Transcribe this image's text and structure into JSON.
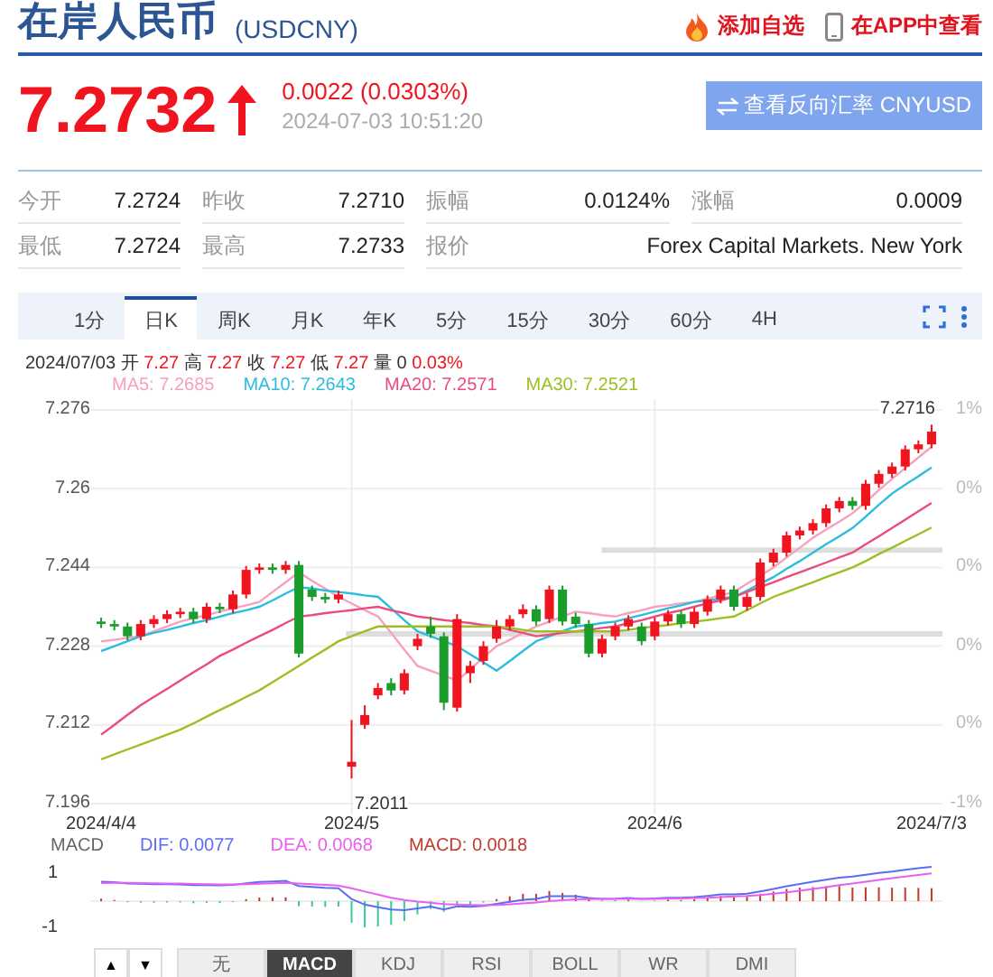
{
  "header": {
    "title": "在岸人民币",
    "code": "(USDCNY)",
    "actions": [
      {
        "kind": "watchlist",
        "label": "添加自选"
      },
      {
        "kind": "app",
        "label": "在APP中查看"
      }
    ]
  },
  "quote": {
    "price": "7.2732",
    "rising": true,
    "change": "0.0022 (0.0303%)",
    "time": "2024-07-03 10:51:20",
    "reverse_button": "查看反向汇率 CNYUSD"
  },
  "stats": [
    [
      {
        "label": "今开",
        "value": "7.2724"
      },
      {
        "label": "昨收",
        "value": "7.2710"
      },
      {
        "label": "振幅",
        "value": "0.0124%"
      },
      {
        "label": "涨幅",
        "value": "0.0009"
      }
    ],
    [
      {
        "label": "最低",
        "value": "7.2724"
      },
      {
        "label": "最高",
        "value": "7.2733"
      },
      {
        "label": "报价",
        "value": "Forex Capital Markets. New York"
      }
    ]
  ],
  "tabs": [
    {
      "label": "1分",
      "selected": false
    },
    {
      "label": "日K",
      "selected": true
    },
    {
      "label": "周K",
      "selected": false
    },
    {
      "label": "月K",
      "selected": false
    },
    {
      "label": "年K",
      "selected": false
    },
    {
      "label": "5分",
      "selected": false
    },
    {
      "label": "15分",
      "selected": false
    },
    {
      "label": "30分",
      "selected": false
    },
    {
      "label": "60分",
      "selected": false
    },
    {
      "label": "4H",
      "selected": false
    }
  ],
  "ohlc": {
    "date": "2024/07/03",
    "fields": [
      {
        "label": "开",
        "value": "7.27",
        "highlighted": true
      },
      {
        "label": "高",
        "value": "7.27",
        "highlighted": true
      },
      {
        "label": "收",
        "value": "7.27",
        "highlighted": true
      },
      {
        "label": "低",
        "value": "7.27",
        "highlighted": true
      },
      {
        "label": "量",
        "value": "0",
        "highlighted": false
      }
    ],
    "change": "0.03%"
  },
  "chart": {
    "ma_values": [
      ": 7.2685",
      ": 7.2643",
      ": 7.2571",
      ": 7.2521"
    ],
    "chart_data": {
      "type": "candlestick",
      "grid": true,
      "ylim": [
        7.196,
        7.276
      ],
      "yticks": [
        {
          "value": 7.276,
          "label": "7.276"
        },
        {
          "value": 7.26,
          "label": "7.26"
        },
        {
          "value": 7.244,
          "label": "7.244"
        },
        {
          "value": 7.228,
          "label": "7.228"
        },
        {
          "value": 7.212,
          "label": "7.212"
        },
        {
          "value": 7.196,
          "label": "7.196"
        }
      ],
      "categories": [
        "2024/4/4",
        null,
        null,
        null,
        null,
        null,
        null,
        null,
        null,
        null,
        null,
        null,
        null,
        null,
        null,
        null,
        null,
        null,
        null,
        "2024/5",
        null,
        null,
        null,
        null,
        null,
        null,
        null,
        null,
        null,
        null,
        null,
        null,
        null,
        null,
        null,
        null,
        null,
        null,
        null,
        null,
        null,
        null,
        "2024/6",
        null,
        null,
        null,
        null,
        null,
        null,
        null,
        null,
        null,
        null,
        null,
        null,
        null,
        null,
        null,
        null,
        null,
        null,
        null,
        null,
        "2024/7/3"
      ],
      "ohlc": [
        [
          7.233,
          7.2338,
          7.2317,
          7.2325
        ],
        [
          7.2325,
          7.2333,
          7.2312,
          7.232
        ],
        [
          7.232,
          7.2328,
          7.2292,
          7.23
        ],
        [
          7.23,
          7.2333,
          7.2292,
          7.2325
        ],
        [
          7.2325,
          7.2343,
          7.2317,
          7.2335
        ],
        [
          7.2335,
          7.2353,
          7.2327,
          7.2345
        ],
        [
          7.2345,
          7.2358,
          7.2337,
          7.235
        ],
        [
          7.235,
          7.2358,
          7.2327,
          7.2335
        ],
        [
          7.2335,
          7.2368,
          7.2327,
          7.236
        ],
        [
          7.236,
          7.2368,
          7.2347,
          7.2355
        ],
        [
          7.2355,
          7.2393,
          7.2347,
          7.2385
        ],
        [
          7.2385,
          7.2443,
          7.2377,
          7.2435
        ],
        [
          7.2435,
          7.2448,
          7.2427,
          7.244
        ],
        [
          7.244,
          7.2448,
          7.2427,
          7.2435
        ],
        [
          7.2435,
          7.2453,
          7.2427,
          7.2445
        ],
        [
          7.2445,
          7.2453,
          7.2257,
          7.2265
        ],
        [
          7.2395,
          7.2403,
          7.2372,
          7.238
        ],
        [
          7.238,
          7.2388,
          7.2367,
          7.2375
        ],
        [
          7.2375,
          7.2393,
          7.2367,
          7.2385
        ],
        [
          7.2035,
          7.213,
          7.2011,
          7.2045
        ],
        [
          7.212,
          7.216,
          7.2112,
          7.214
        ],
        [
          7.218,
          7.2205,
          7.2172,
          7.2195
        ],
        [
          7.2205,
          7.2215,
          7.218,
          7.219
        ],
        [
          7.219,
          7.2233,
          7.2182,
          7.2225
        ],
        [
          7.228,
          7.2305,
          7.2272,
          7.2295
        ],
        [
          7.232,
          7.234,
          7.2297,
          7.2305
        ],
        [
          7.23,
          7.2308,
          7.215,
          7.2165
        ],
        [
          7.2155,
          7.2345,
          7.2147,
          7.2335
        ],
        [
          7.2225,
          7.225,
          7.2205,
          7.224
        ],
        [
          7.225,
          7.229,
          7.2242,
          7.228
        ],
        [
          7.2295,
          7.2333,
          7.2287,
          7.232
        ],
        [
          7.232,
          7.2343,
          7.2312,
          7.2335
        ],
        [
          7.2345,
          7.2365,
          7.2337,
          7.2355
        ],
        [
          7.2355,
          7.2363,
          7.2322,
          7.233
        ],
        [
          7.2335,
          7.2403,
          7.2327,
          7.2395
        ],
        [
          7.2395,
          7.2403,
          7.2322,
          7.233
        ],
        [
          7.234,
          7.2348,
          7.2317,
          7.2325
        ],
        [
          7.2325,
          7.2333,
          7.2257,
          7.2265
        ],
        [
          7.2265,
          7.2303,
          7.2257,
          7.2295
        ],
        [
          7.23,
          7.2328,
          7.2292,
          7.232
        ],
        [
          7.232,
          7.2343,
          7.2312,
          7.2335
        ],
        [
          7.232,
          7.2328,
          7.2282,
          7.229
        ],
        [
          7.23,
          7.2338,
          7.2292,
          7.233
        ],
        [
          7.233,
          7.2353,
          7.2322,
          7.2345
        ],
        [
          7.2345,
          7.2353,
          7.2317,
          7.2325
        ],
        [
          7.2325,
          7.2358,
          7.2317,
          7.235
        ],
        [
          7.235,
          7.2383,
          7.2342,
          7.2375
        ],
        [
          7.2375,
          7.2403,
          7.2367,
          7.2395
        ],
        [
          7.2395,
          7.2403,
          7.2352,
          7.236
        ],
        [
          7.236,
          7.2388,
          7.2352,
          7.238
        ],
        [
          7.238,
          7.2458,
          7.2372,
          7.245
        ],
        [
          7.245,
          7.2478,
          7.2442,
          7.247
        ],
        [
          7.247,
          7.2513,
          7.2462,
          7.2505
        ],
        [
          7.2505,
          7.2523,
          7.2497,
          7.2515
        ],
        [
          7.2515,
          7.2538,
          7.2507,
          7.253
        ],
        [
          7.253,
          7.2568,
          7.2522,
          7.256
        ],
        [
          7.256,
          7.2583,
          7.2552,
          7.2575
        ],
        [
          7.2575,
          7.2583,
          7.2557,
          7.2565
        ],
        [
          7.2565,
          7.2618,
          7.2557,
          7.261
        ],
        [
          7.261,
          7.2638,
          7.2602,
          7.263
        ],
        [
          7.263,
          7.2653,
          7.2622,
          7.2645
        ],
        [
          7.2645,
          7.2688,
          7.2637,
          7.268
        ],
        [
          7.268,
          7.2698,
          7.2672,
          7.269
        ],
        [
          7.269,
          7.273,
          7.2682,
          7.2716
        ]
      ],
      "series": [
        {
          "name": "MA5",
          "type": "line",
          "color": "#f7a1bd",
          "values": [
            7.229,
            7.2293,
            7.2297,
            7.23,
            7.231,
            7.232,
            7.233,
            7.2337,
            7.2343,
            7.235,
            7.2357,
            7.2363,
            7.237,
            7.239,
            7.241,
            7.243,
            7.2413,
            7.2397,
            7.238,
            7.2367,
            7.2353,
            7.234,
            7.2307,
            7.2273,
            7.224,
            7.223,
            7.222,
            7.221,
            7.2233,
            7.2257,
            7.228,
            7.2293,
            7.2307,
            7.232,
            7.233,
            7.234,
            7.235,
            7.2347,
            7.2343,
            7.234,
            7.2347,
            7.2353,
            7.236,
            7.2363,
            7.2367,
            7.237,
            7.2377,
            7.2383,
            7.239,
            7.2407,
            7.2423,
            7.244,
            7.246,
            7.248,
            7.25,
            7.2517,
            7.2533,
            7.255,
            7.2573,
            7.2597,
            7.262,
            7.2642,
            7.2663,
            7.2685
          ]
        },
        {
          "name": "MA10",
          "type": "line",
          "color": "#2bbde0",
          "values": [
            7.227,
            7.228,
            7.229,
            7.23,
            7.2307,
            7.2313,
            7.232,
            7.2327,
            7.2333,
            7.234,
            7.2347,
            7.2353,
            7.236,
            7.2373,
            7.2387,
            7.24,
            7.2397,
            7.2393,
            7.239,
            7.2387,
            7.2383,
            7.238,
            7.2357,
            7.2333,
            7.231,
            7.23,
            7.229,
            7.228,
            7.2263,
            7.2247,
            7.223,
            7.225,
            7.227,
            7.229,
            7.23,
            7.231,
            7.232,
            7.2323,
            7.2327,
            7.233,
            7.2337,
            7.2343,
            7.235,
            7.2357,
            7.2363,
            7.237,
            7.2373,
            7.2377,
            7.238,
            7.2393,
            7.2407,
            7.242,
            7.2437,
            7.2453,
            7.247,
            7.2487,
            7.2503,
            7.252,
            7.2543,
            7.2567,
            7.259,
            7.2608,
            7.2625,
            7.2643
          ]
        },
        {
          "name": "MA20",
          "type": "line",
          "color": "#eb4c7d",
          "values": [
            7.21,
            7.212,
            7.214,
            7.216,
            7.2177,
            7.2193,
            7.221,
            7.2227,
            7.2243,
            7.226,
            7.2273,
            7.2287,
            7.23,
            7.2313,
            7.2327,
            7.234,
            7.2343,
            7.2347,
            7.235,
            7.2353,
            7.2357,
            7.236,
            7.2353,
            7.2347,
            7.234,
            7.2337,
            7.2333,
            7.233,
            7.2327,
            7.2323,
            7.232,
            7.2313,
            7.2307,
            7.23,
            7.2303,
            7.2307,
            7.231,
            7.2313,
            7.2317,
            7.232,
            7.2327,
            7.2333,
            7.234,
            7.2347,
            7.2353,
            7.236,
            7.2367,
            7.2373,
            7.238,
            7.239,
            7.24,
            7.241,
            7.242,
            7.243,
            7.244,
            7.245,
            7.246,
            7.247,
            7.2487,
            7.2503,
            7.252,
            7.2537,
            7.2554,
            7.2571
          ]
        },
        {
          "name": "MA30",
          "type": "line",
          "color": "#9cc023",
          "values": [
            7.205,
            7.206,
            7.207,
            7.208,
            7.209,
            7.21,
            7.211,
            7.2123,
            7.2137,
            7.215,
            7.2163,
            7.2177,
            7.219,
            7.2207,
            7.2223,
            7.224,
            7.2257,
            7.2273,
            7.229,
            7.23,
            7.231,
            7.232,
            7.232,
            7.232,
            7.232,
            7.232,
            7.232,
            7.232,
            7.232,
            7.232,
            7.232,
            7.2317,
            7.2313,
            7.231,
            7.231,
            7.231,
            7.231,
            7.231,
            7.231,
            7.231,
            7.2313,
            7.2317,
            7.232,
            7.2323,
            7.2327,
            7.233,
            7.2333,
            7.2337,
            7.234,
            7.2353,
            7.2367,
            7.238,
            7.239,
            7.24,
            7.241,
            7.242,
            7.243,
            7.244,
            7.2453,
            7.2467,
            7.248,
            7.2494,
            7.2507,
            7.2521
          ]
        }
      ]
    },
    "right_ticks": [
      "1%",
      "0%",
      "0%",
      "0%",
      "0%",
      "-1%"
    ],
    "high_label": "7.2716",
    "low_label": "7.2011"
  },
  "macd": {
    "label": "MACD",
    "legend": [
      {
        "label": "DIF: 0.0077",
        "color": "#5b6cf5"
      },
      {
        "label": "DEA: 0.0068",
        "color": "#ea5ef0"
      },
      {
        "label": "MACD: 0.0018",
        "color": "#c0392b"
      }
    ],
    "y_ticks": [
      "1",
      "-1"
    ]
  },
  "indicators": {
    "arrows": [
      "▲",
      "▼"
    ],
    "items": [
      {
        "label": "无",
        "selected": false
      },
      {
        "label": "MACD",
        "selected": true
      },
      {
        "label": "KDJ",
        "selected": false
      },
      {
        "label": "RSI",
        "selected": false
      },
      {
        "label": "BOLL",
        "selected": false
      },
      {
        "label": "WR",
        "selected": false
      },
      {
        "label": "DMI",
        "selected": false
      }
    ]
  }
}
